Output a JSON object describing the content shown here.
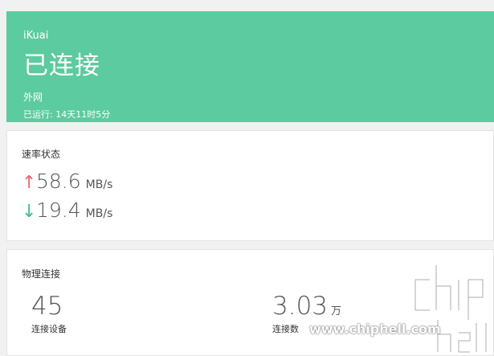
{
  "hero": {
    "brand": "iKuai",
    "status": "已连接",
    "network": "外网",
    "uptime_label": "已运行: ",
    "uptime_value": "14天11时5分",
    "color": "#5ccb9f"
  },
  "speed": {
    "title": "速率状态",
    "upload": {
      "icon": "arrow-up-icon",
      "value": "58.6",
      "unit": "MB/s",
      "color": "#e06a6a"
    },
    "download": {
      "icon": "arrow-down-icon",
      "value": "19.4",
      "unit": "MB/s",
      "color": "#3bbf8a"
    }
  },
  "connections": {
    "title": "物理连接",
    "devices": {
      "value": "45",
      "label": "连接设备"
    },
    "sessions": {
      "value": "3.03",
      "suffix": "万",
      "label": "连接数"
    }
  },
  "watermark": {
    "logo": "chiphell-logo",
    "url": "www.chiphell.com"
  }
}
